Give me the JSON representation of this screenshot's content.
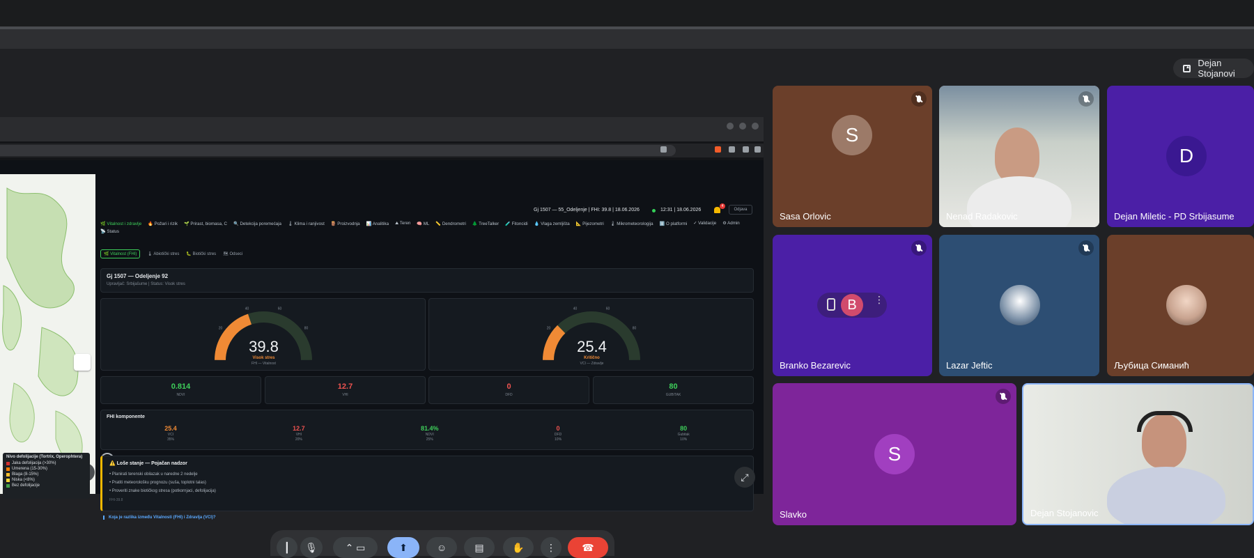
{
  "presenter": {
    "label": "Dejan Stojanovi"
  },
  "shared_screen": {
    "header": {
      "info": "Gj 1507 — 55_Odeljenje | FHI: 39.8 | 18.06.2026",
      "time": "12:31 | 18.06.2026",
      "badge": "4",
      "logout": "Odjava"
    },
    "nav_items": [
      "🌿 Vitalnost i zdravlje",
      "🔥 Požari i rizik",
      "🌱 Prirast, biomasa, C",
      "🔍 Detekcija poremećaja",
      "🌡 Klima i ranjivost",
      "🪵 Proizvodnja",
      "📊 Analitika",
      "⛰ Teren",
      "🧠 ML",
      "📏 Dendrometri",
      "🌲 TreeTalker",
      "🧪 Fitoncidi",
      "💧 Vlaga zemljišta",
      "📐 Pijezometri",
      "🌡 Mikrometeorologija",
      "ℹ️ O platformi",
      "✓ Validacije",
      "⚙ Admin",
      "📡 Status"
    ],
    "subtabs": [
      "🌿 Vitalnost (FHI)",
      "🌡 Abiotički stres",
      "🐛 Biotički stres",
      "🗺 Odseci"
    ],
    "title": {
      "heading": "Gj 1507 — Odeljenje 92",
      "subtitle": "Upravljač: Srbijašume | Status: Visok stres"
    },
    "gauges": [
      {
        "value": "39.8",
        "level": 0.398,
        "status": "Visok stres",
        "caption": "FHI — Vitalnost",
        "ticks": [
          "20",
          "40",
          "60",
          "80"
        ]
      },
      {
        "value": "25.4",
        "level": 0.254,
        "status": "Kritično",
        "caption": "VCI — Zdravlje",
        "ticks": [
          "20",
          "40",
          "60",
          "80"
        ]
      }
    ],
    "stats": [
      {
        "value": "0.814",
        "key": "NDVI",
        "color": "#3ecf5a"
      },
      {
        "value": "12.7",
        "key": "VHI",
        "color": "#ef5350"
      },
      {
        "value": "0",
        "key": "DFD",
        "color": "#ef5350"
      },
      {
        "value": "80",
        "key": "GUBITAK",
        "color": "#3ecf5a"
      }
    ],
    "components": {
      "heading": "FHI komponente",
      "items": [
        {
          "value": "25.4",
          "key": "VCI",
          "weight": "35%",
          "color": "#f08a35"
        },
        {
          "value": "12.7",
          "key": "VHI",
          "weight": "20%",
          "color": "#ef5350"
        },
        {
          "value": "81.4%",
          "key": "NDVI",
          "weight": "25%",
          "color": "#3ecf5a"
        },
        {
          "value": "0",
          "key": "DFD",
          "weight": "10%",
          "color": "#ef5350"
        },
        {
          "value": "80",
          "key": "Gubitak",
          "weight": "10%",
          "color": "#3ecf5a"
        }
      ]
    },
    "alert": {
      "heading": "⚠️ Loše stanje — Pojačan nadzor",
      "items": [
        "Planirati terenski obilazak u narednе 2 nedelje",
        "Pratiti meteorološku prognozu (suša, toplotni talas)",
        "Proveriti znake biotičkog stresa (potkornjaci, defolijacija)"
      ],
      "footer": "FHI-39.8"
    },
    "faq": "Koja je razlika između Vitalnosti (FHI) i Zdravlja (VCI)?",
    "map_legend": {
      "title": "Nivo defolijacije (Tortrix, Operophtera)",
      "items": [
        {
          "label": "Jaka defolijacija (>30%)",
          "color": "#d32f2f"
        },
        {
          "label": "Umerena (15-30%)",
          "color": "#f57c00"
        },
        {
          "label": "Blaga (8-15%)",
          "color": "#fbc02d"
        },
        {
          "label": "Niska (<8%)",
          "color": "#fdd835"
        },
        {
          "label": "Bez defolijacije",
          "color": "#43a047"
        }
      ]
    }
  },
  "participants": [
    {
      "name": "Sasa Orlovic",
      "initial": "S"
    },
    {
      "name": "Nenad Radakovic"
    },
    {
      "name": "Dejan Miletic - PD Srbijasume",
      "initial": "D"
    },
    {
      "name": "Branko Bezarevic",
      "initial": "B"
    },
    {
      "name": "Lazar Jeftic"
    },
    {
      "name": "Љубица Симанић"
    },
    {
      "name": "Slavko",
      "initial": "S"
    },
    {
      "name": "Dejan Stojanovic"
    }
  ]
}
